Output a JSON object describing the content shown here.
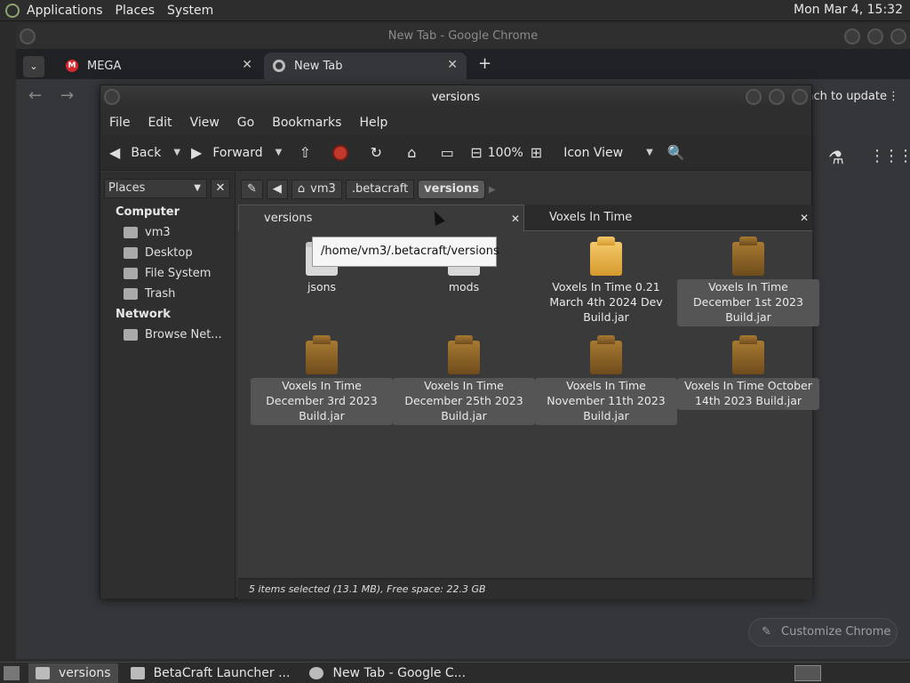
{
  "top_panel": {
    "menus": [
      "Applications",
      "Places",
      "System"
    ],
    "clock": "Mon Mar  4, 15:32"
  },
  "chrome": {
    "window_title": "New Tab - Google Chrome",
    "tabs": [
      {
        "label": "MEGA",
        "close": "✕"
      },
      {
        "label": "New Tab",
        "close": "✕"
      }
    ],
    "new_tab": "+",
    "update_text": "nch to update",
    "customize_label": "Customize Chrome"
  },
  "filemanager": {
    "title": "versions",
    "menu": [
      "File",
      "Edit",
      "View",
      "Go",
      "Bookmarks",
      "Help"
    ],
    "toolbar": {
      "back": "Back",
      "forward": "Forward",
      "zoom": "100%",
      "view_mode": "Icon View"
    },
    "sidebar": {
      "combo": "Places",
      "sections": [
        {
          "heading": "Computer",
          "items": [
            "vm3",
            "Desktop",
            "File System",
            "Trash"
          ]
        },
        {
          "heading": "Network",
          "items": [
            "Browse Net..."
          ]
        }
      ]
    },
    "path": [
      "vm3",
      ".betacraft",
      "versions"
    ],
    "tabs": [
      {
        "label": "versions"
      },
      {
        "label": "Voxels In Time"
      }
    ],
    "tooltip": "/home/vm3/.betacraft/versions",
    "files": [
      {
        "name": "jsons",
        "kind": "folder",
        "selected": false
      },
      {
        "name": "mods",
        "kind": "folder",
        "selected": false
      },
      {
        "name": "Voxels In Time 0.21 March 4th 2024 Dev Build.jar",
        "kind": "jar-gold",
        "selected": false
      },
      {
        "name": "Voxels In Time December 1st 2023 Build.jar",
        "kind": "jar",
        "selected": true
      },
      {
        "name": "Voxels In Time December 3rd 2023 Build.jar",
        "kind": "jar",
        "selected": true
      },
      {
        "name": "Voxels In Time December 25th 2023 Build.jar",
        "kind": "jar",
        "selected": true
      },
      {
        "name": "Voxels In Time November 11th 2023 Build.jar",
        "kind": "jar",
        "selected": true
      },
      {
        "name": "Voxels In Time October 14th 2023 Build.jar",
        "kind": "jar",
        "selected": true
      }
    ],
    "status": "5 items selected (13.1 MB), Free space: 22.3 GB"
  },
  "taskbar": {
    "items": [
      "versions",
      "BetaCraft Launcher ...",
      "New Tab - Google C..."
    ]
  }
}
